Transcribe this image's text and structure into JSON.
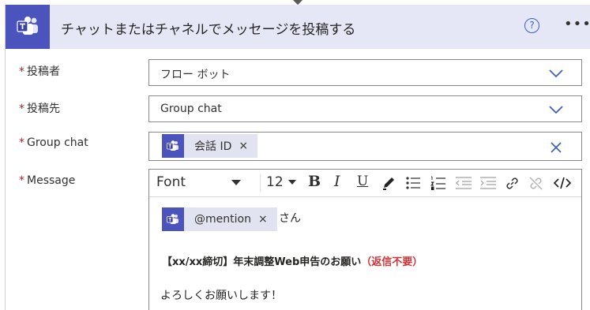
{
  "header": {
    "title": "チャットまたはチャネルでメッセージを投稿する",
    "help_glyph": "?",
    "more_glyph": "•••",
    "icon": "teams-icon"
  },
  "fields": {
    "poster": {
      "label": "投稿者",
      "value": "フロー ボット"
    },
    "post_in": {
      "label": "投稿先",
      "value": "Group chat"
    },
    "group_chat": {
      "label": "Group chat",
      "token": "会話 ID",
      "token_close": "×"
    },
    "message": {
      "label": "Message"
    }
  },
  "required_mark": "*",
  "toolbar": {
    "font": "Font",
    "size": "12",
    "bold": "B",
    "italic": "I",
    "underline": "U",
    "icons": [
      "highlight-pen-icon",
      "bullet-list-icon",
      "numbered-list-icon",
      "decrease-indent-icon",
      "increase-indent-icon",
      "link-icon",
      "unlink-icon",
      "code-view-icon"
    ]
  },
  "message_body": {
    "mention_token": "@mention",
    "mention_close": "×",
    "honorific": "さん",
    "subject_bold": "【xx/xx締切】年末調整Web申告のお願い",
    "subject_red": "（返信不要）",
    "closing": "よろしくお願いします！"
  },
  "colors": {
    "teams_purple": "#4b53bc",
    "header_bg": "#e6e7f6",
    "accent_blue": "#3b5fc0",
    "required_red": "#a4262c",
    "emphasis_red": "#d13438"
  }
}
